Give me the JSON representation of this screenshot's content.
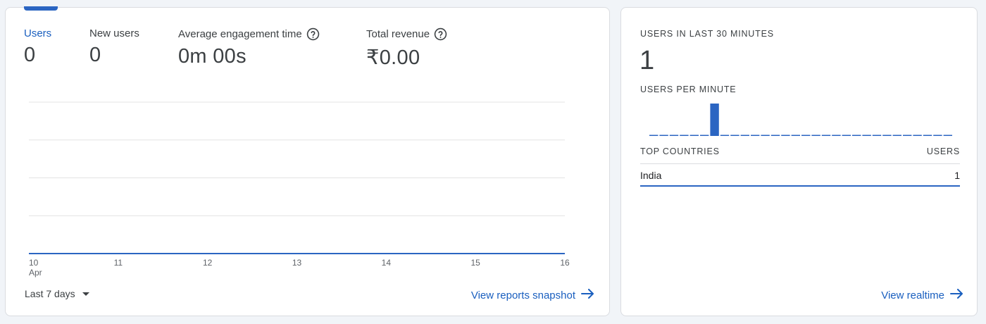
{
  "overview": {
    "metrics": [
      {
        "label": "Users",
        "value": "0",
        "has_help": false,
        "active": true
      },
      {
        "label": "New users",
        "value": "0",
        "has_help": false,
        "active": false
      },
      {
        "label": "Average engagement time",
        "value": "0m 00s",
        "has_help": true,
        "active": false
      },
      {
        "label": "Total revenue",
        "value": "₹0.00",
        "has_help": true,
        "active": false
      }
    ],
    "chart_data": {
      "type": "line",
      "x": [
        "10",
        "11",
        "12",
        "13",
        "14",
        "15",
        "16"
      ],
      "x_month_label": "Apr",
      "series": [
        {
          "values": [
            0,
            0,
            0,
            0,
            0,
            0,
            0
          ]
        }
      ],
      "grid": true
    },
    "date_range_label": "Last 7 days",
    "link_label": "View reports snapshot"
  },
  "realtime": {
    "title": "USERS IN LAST 30 MINUTES",
    "value": "1",
    "per_minute_title": "USERS PER MINUTE",
    "per_minute_data": {
      "type": "bar",
      "values": [
        0,
        0,
        0,
        0,
        0,
        0,
        1,
        0,
        0,
        0,
        0,
        0,
        0,
        0,
        0,
        0,
        0,
        0,
        0,
        0,
        0,
        0,
        0,
        0,
        0,
        0,
        0,
        0,
        0,
        0
      ]
    },
    "countries_header": "TOP COUNTRIES",
    "users_header": "USERS",
    "countries": [
      {
        "name": "India",
        "users": "1"
      }
    ],
    "link_label": "View realtime"
  },
  "colors": {
    "accent": "#2b65c2",
    "link": "#1a5fbf",
    "grid": "#e3e3e3"
  },
  "icons": {
    "help": "help-circle-icon",
    "arrow": "arrow-right-icon",
    "caret": "caret-down-icon"
  }
}
